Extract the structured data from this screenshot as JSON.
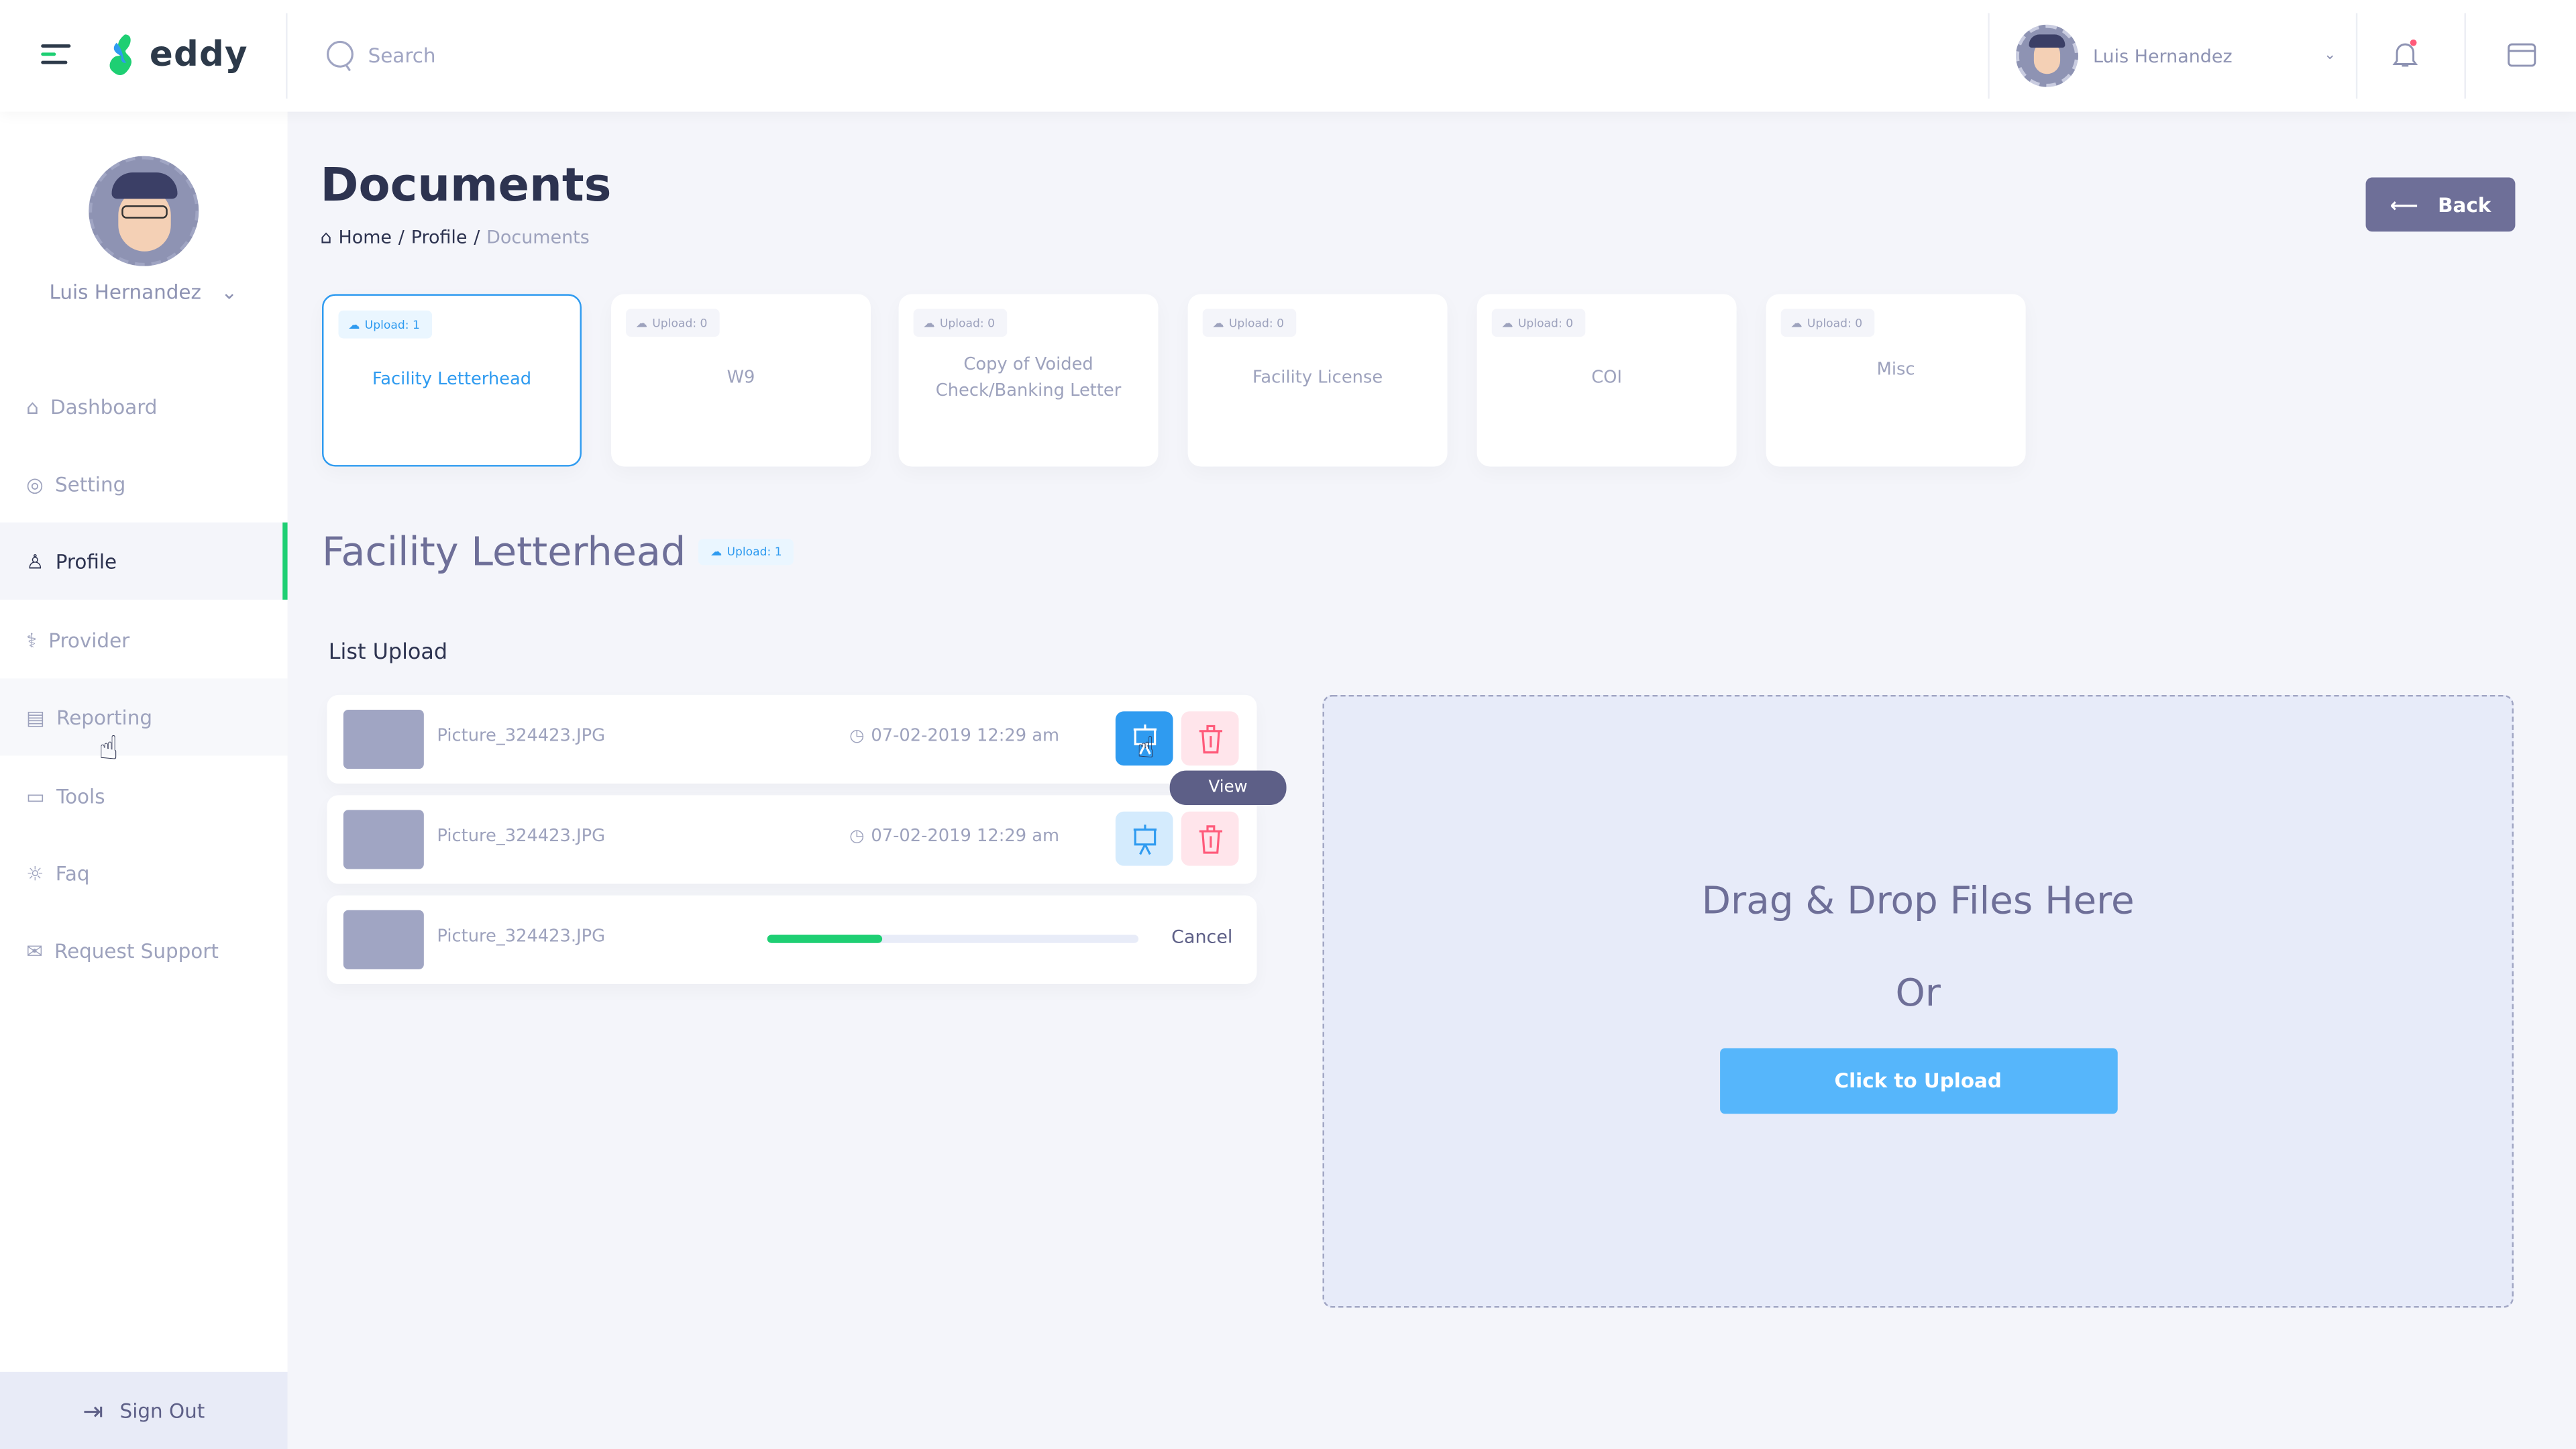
{
  "header": {
    "brand": "eddy",
    "search_placeholder": "Search",
    "user_name": "Luis Hernandez"
  },
  "sidebar": {
    "user_name": "Luis Hernandez",
    "items": [
      {
        "label": "Dashboard"
      },
      {
        "label": "Setting"
      },
      {
        "label": "Profile"
      },
      {
        "label": "Provider"
      },
      {
        "label": "Reporting"
      },
      {
        "label": "Tools"
      },
      {
        "label": "Faq"
      },
      {
        "label": "Request Support"
      }
    ],
    "sign_out": "Sign Out"
  },
  "page": {
    "title": "Documents",
    "breadcrumb": [
      "Home",
      "Profile",
      "Documents"
    ],
    "back_label": "Back"
  },
  "categories": [
    {
      "badge": "Upload: 1",
      "title": "Facility Letterhead"
    },
    {
      "badge": "Upload: 0",
      "title": "W9"
    },
    {
      "badge": "Upload: 0",
      "title": "Copy of Voided Check/Banking Letter"
    },
    {
      "badge": "Upload: 0",
      "title": "Facility License"
    },
    {
      "badge": "Upload: 0",
      "title": "COI"
    },
    {
      "badge": "Upload: 0",
      "title": "Misc"
    }
  ],
  "section": {
    "title": "Facility Letterhead",
    "badge": "Upload: 1",
    "list_title": "List Upload"
  },
  "uploads": [
    {
      "name": "Picture_324423.JPG",
      "date": "07-02-2019 12:29 am"
    },
    {
      "name": "Picture_324423.JPG",
      "date": "07-02-2019 12:29 am"
    },
    {
      "name": "Picture_324423.JPG",
      "progress_percent": 31,
      "cancel_label": "Cancel"
    }
  ],
  "tooltip": "View",
  "dropzone": {
    "title": "Drag & Drop Files Here",
    "or": "Or",
    "button": "Click to Upload"
  },
  "colors": {
    "accent": "#2f9bf0",
    "green": "#1ecf73",
    "danger": "#ff5a7a",
    "dark": "#5d5f87"
  }
}
